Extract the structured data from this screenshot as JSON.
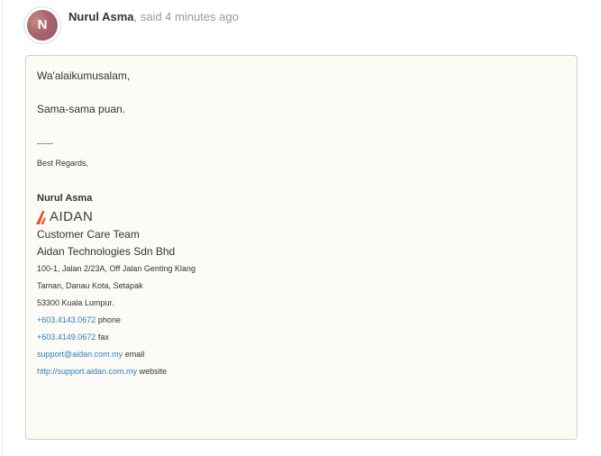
{
  "comment": {
    "avatar_initial": "N",
    "author": "Nurul Asma",
    "meta": ", said 4 minutes ago",
    "greeting": "Wa'alaikumusalam,",
    "line2": "Sama-sama puan.",
    "separator": "------",
    "regards": "Best Regards,",
    "signature": {
      "name": "Nurul Asma",
      "logo_text": "AIDAN",
      "team": "Customer Care Team",
      "company": "Aidan Technologies Sdn Bhd",
      "address1": "100-1, Jalan 2/23A, Off Jalan Genting Klang",
      "address2": "Taman, Danau Kota, Setapak",
      "address3": "53300 Kuala Lumpur.",
      "phone": "+603.4143.0672",
      "phone_label": " phone",
      "fax": "+603.4149.0672",
      "fax_label": " fax",
      "email": "support@aidan.com.my",
      "email_label": " email",
      "website": "http://support.aidan.com.my",
      "website_label": " website"
    }
  },
  "colors": {
    "link": "#2d7fc2",
    "logo_accent": "#e8542a",
    "box_background": "#fcfbf5"
  }
}
